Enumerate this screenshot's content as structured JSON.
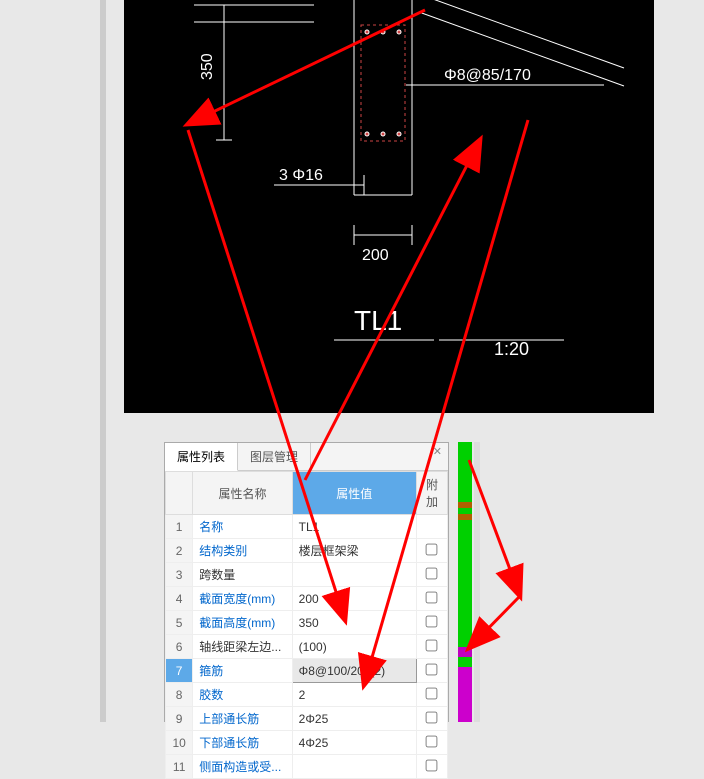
{
  "cad": {
    "dim_height": "350",
    "dim_width": "200",
    "rebar_bottom": "3 Φ16",
    "rebar_stirrup": "Φ8@85/170",
    "section_label": "TL1",
    "scale": "1:20"
  },
  "panel": {
    "tabs": {
      "props": "属性列表",
      "layers": "图层管理"
    },
    "headers": {
      "name": "属性名称",
      "value": "属性值",
      "extra": "附加"
    },
    "rows": [
      {
        "n": "1",
        "label": "名称",
        "value": "TL1",
        "plain": false
      },
      {
        "n": "2",
        "label": "结构类别",
        "value": "楼层框架梁",
        "plain": false
      },
      {
        "n": "3",
        "label": "跨数量",
        "value": "",
        "plain": true
      },
      {
        "n": "4",
        "label": "截面宽度(mm)",
        "value": "200",
        "plain": false
      },
      {
        "n": "5",
        "label": "截面高度(mm)",
        "value": "350",
        "plain": false
      },
      {
        "n": "6",
        "label": "轴线距梁左边...",
        "value": "(100)",
        "plain": true
      },
      {
        "n": "7",
        "label": "箍筋",
        "value": "Φ8@100/200(2)",
        "plain": false,
        "selected": true
      },
      {
        "n": "8",
        "label": "胶数",
        "value": "2",
        "plain": false
      },
      {
        "n": "9",
        "label": "上部通长筋",
        "value": "2Φ25",
        "plain": false
      },
      {
        "n": "10",
        "label": "下部通长筋",
        "value": "4Φ25",
        "plain": false
      },
      {
        "n": "11",
        "label": "侧面构造或受...",
        "value": "",
        "plain": false
      }
    ]
  }
}
